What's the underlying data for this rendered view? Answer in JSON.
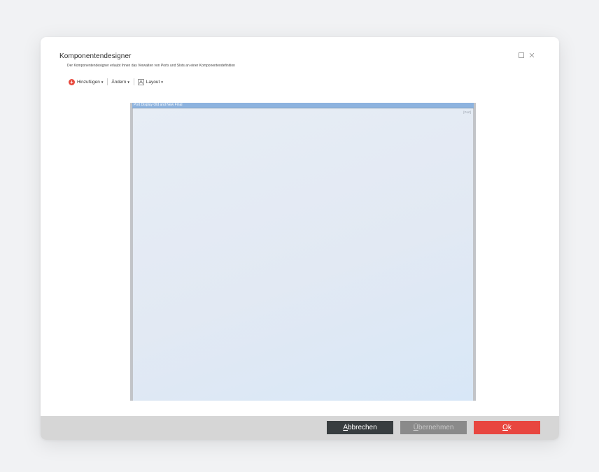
{
  "dialog": {
    "title": "Komponentendesigner",
    "subtitle": "Der Komponentendesigner erlaubt Ihnen das Verwalten von Ports und Slots an einer Komponentendefinition"
  },
  "toolbar": {
    "add_label": "Hinzufügen",
    "change_label": "Ändern",
    "layout_label": "Layout"
  },
  "canvas": {
    "header_title": "Port Display Old and New Final",
    "port_label": "[Port]"
  },
  "footer": {
    "cancel_mnemonic": "A",
    "cancel_rest": "bbrechen",
    "apply_mnemonic": "Ü",
    "apply_rest": "bernehmen",
    "ok_mnemonic": "O",
    "ok_rest": "k"
  },
  "colors": {
    "accent": "#e8463f",
    "cancel_bg": "#383d3f",
    "apply_bg": "#8a8a8a",
    "canvas_header": "#8db3df"
  },
  "icons": [
    "maximize-icon",
    "close-icon",
    "add-icon",
    "layout-icon",
    "caret-down-icon"
  ]
}
